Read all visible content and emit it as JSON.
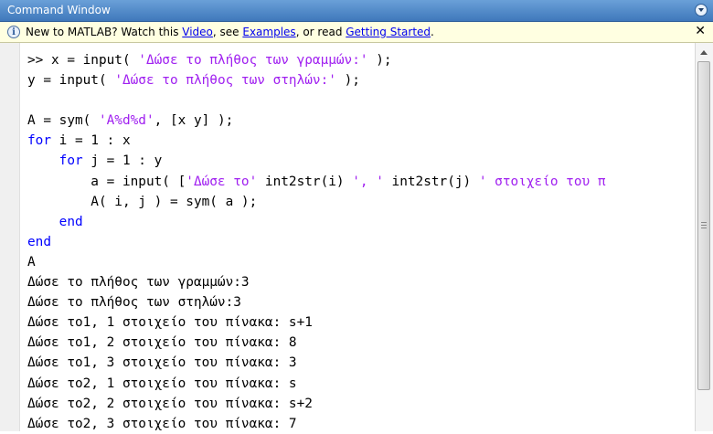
{
  "window": {
    "title": "Command Window"
  },
  "infobar": {
    "prefix": "New to MATLAB? Watch this ",
    "link_video": "Video",
    "sep1": ", see ",
    "link_examples": "Examples",
    "sep2": ", or read ",
    "link_getting_started": "Getting Started",
    "suffix": "."
  },
  "console": {
    "lines": [
      [
        {
          "t": ">> x = input( "
        },
        {
          "t": "'Δώσε το πλήθος των γραμμών:'",
          "c": "str"
        },
        {
          "t": " );"
        }
      ],
      [
        {
          "t": "y = input( "
        },
        {
          "t": "'Δώσε το πλήθος των στηλών:'",
          "c": "str"
        },
        {
          "t": " );"
        }
      ],
      [
        {
          "t": ""
        }
      ],
      [
        {
          "t": "A = sym( "
        },
        {
          "t": "'A%d%d'",
          "c": "str"
        },
        {
          "t": ", [x y] );"
        }
      ],
      [
        {
          "t": "for",
          "c": "kw"
        },
        {
          "t": " i = 1 : x"
        }
      ],
      [
        {
          "t": "    "
        },
        {
          "t": "for",
          "c": "kw"
        },
        {
          "t": " j = 1 : y"
        }
      ],
      [
        {
          "t": "        a = input( ["
        },
        {
          "t": "'Δώσε το'",
          "c": "str"
        },
        {
          "t": " int2str(i) "
        },
        {
          "t": "', '",
          "c": "str"
        },
        {
          "t": " int2str(j) "
        },
        {
          "t": "' στοιχείο του π",
          "c": "str"
        }
      ],
      [
        {
          "t": "        A( i, j ) = sym( a );"
        }
      ],
      [
        {
          "t": "    "
        },
        {
          "t": "end",
          "c": "kw"
        }
      ],
      [
        {
          "t": "end",
          "c": "kw"
        }
      ],
      [
        {
          "t": "A"
        }
      ],
      [
        {
          "t": "Δώσε το πλήθος των γραμμών:3"
        }
      ],
      [
        {
          "t": "Δώσε το πλήθος των στηλών:3"
        }
      ],
      [
        {
          "t": "Δώσε το1, 1 στοιχείο του πίνακα: s+1"
        }
      ],
      [
        {
          "t": "Δώσε το1, 2 στοιχείο του πίνακα: 8"
        }
      ],
      [
        {
          "t": "Δώσε το1, 3 στοιχείο του πίνακα: 3"
        }
      ],
      [
        {
          "t": "Δώσε το2, 1 στοιχείο του πίνακα: s"
        }
      ],
      [
        {
          "t": "Δώσε το2, 2 στοιχείο του πίνακα: s+2"
        }
      ],
      [
        {
          "t": "Δώσε το2, 3 στοιχείο του πίνακα: 7"
        }
      ]
    ]
  },
  "icons": {
    "info": "info-icon",
    "close": "close-icon",
    "menu": "chevron-down-icon"
  },
  "colors": {
    "keyword": "#0000ff",
    "string": "#a020f0",
    "title_bar": "#4f86c6",
    "info_bg": "#ffffe1"
  }
}
